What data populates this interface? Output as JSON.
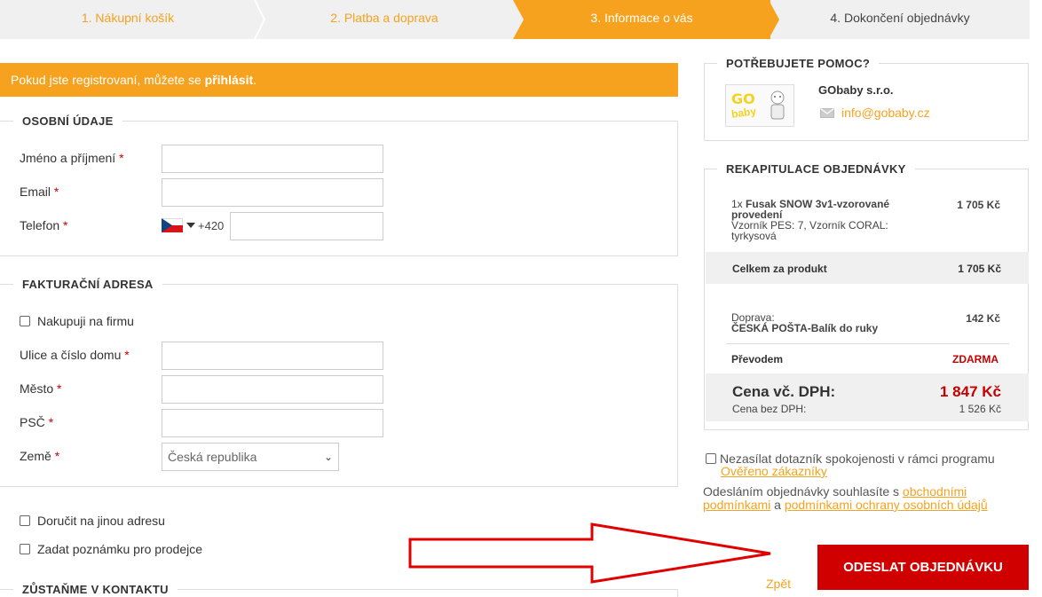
{
  "steps": [
    {
      "label": "1. Nákupní košík"
    },
    {
      "label": "2. Platba a doprava"
    },
    {
      "label": "3. Informace o vás"
    },
    {
      "label": "4. Dokončení objednávky"
    }
  ],
  "login": {
    "text": "Pokud jste registrovaní, můžete se ",
    "link": "přihlásit",
    "period": "."
  },
  "personal": {
    "legend": "OSOBNÍ ÚDAJE",
    "name_label": "Jméno a příjmení",
    "email_label": "Email",
    "phone_label": "Telefon",
    "phone_prefix": "+420",
    "required_mark": "*"
  },
  "billing": {
    "legend": "FAKTURAČNÍ ADRESA",
    "company_checkbox": "Nakupuji na firmu",
    "street_label": "Ulice a číslo domu",
    "city_label": "Město",
    "zip_label": "PSČ",
    "country_label": "Země",
    "country_value": "Česká republika"
  },
  "options": {
    "other_address": "Doručit na jinou adresu",
    "note": "Zadat poznámku pro prodejce"
  },
  "contact": {
    "legend": "ZŮSTAŇME V KONTAKTU"
  },
  "help": {
    "legend": "POTŘEBUJETE POMOC?",
    "logo_top": "GO",
    "logo_bottom": "baby",
    "company": "GObaby s.r.o.",
    "email": "info@gobaby.cz"
  },
  "recap": {
    "legend": "REKAPITULACE OBJEDNÁVKY",
    "item_qty": "1x",
    "item_name_line1": "Fusak SNOW 3v1-vzorované",
    "item_name_line2": "provedení",
    "item_variant_line1": "Vzorník PES: 7, Vzorník CORAL:",
    "item_variant_line2": "tyrkysová",
    "item_price": "1 705 Kč",
    "product_total_label": "Celkem za produkt",
    "product_total_value": "1 705 Kč",
    "shipping_label": "Doprava:",
    "shipping_name": "ČESKÁ POŠTA-Balík do ruky",
    "shipping_price": "142 Kč",
    "payment_label": "Převodem",
    "payment_price": "ZDARMA",
    "total_label": "Cena vč. DPH:",
    "total_value": "1 847 Kč",
    "net_label": "Cena bez DPH:",
    "net_value": "1 526 Kč"
  },
  "survey": {
    "text": "Nezasílat dotazník spokojenosti v rámci programu",
    "link": "Ověřeno zákazníky"
  },
  "terms": {
    "text1": "Odesláním objednávky souhlasíte s ",
    "link1_a": "obchodními",
    "link1_b": "podmínkami",
    "and": " a ",
    "link2": "podmínkami ochrany osobních údajů"
  },
  "actions": {
    "submit": "ODESLAT OBJEDNÁVKU",
    "back": "Zpět"
  },
  "colors": {
    "accent": "#f6a21e",
    "danger": "#d00000",
    "price_red": "#c40000"
  }
}
